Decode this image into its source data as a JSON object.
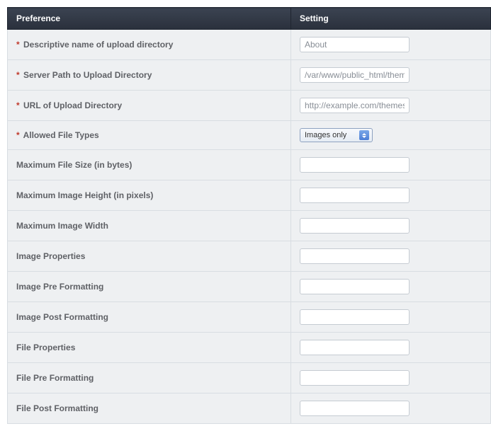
{
  "headers": {
    "preference": "Preference",
    "setting": "Setting"
  },
  "rows": [
    {
      "required": true,
      "label": "Descriptive name of upload directory",
      "type": "text",
      "value": "About"
    },
    {
      "required": true,
      "label": "Server Path to Upload Directory",
      "type": "text",
      "value": "/var/www/public_html/them"
    },
    {
      "required": true,
      "label": "URL of Upload Directory",
      "type": "text",
      "value": "http://example.com/themes"
    },
    {
      "required": true,
      "label": "Allowed File Types",
      "type": "select",
      "value": "Images only"
    },
    {
      "required": false,
      "label": "Maximum File Size (in bytes)",
      "type": "text",
      "value": ""
    },
    {
      "required": false,
      "label": "Maximum Image Height (in pixels)",
      "type": "text",
      "value": ""
    },
    {
      "required": false,
      "label": "Maximum Image Width",
      "type": "text",
      "value": ""
    },
    {
      "required": false,
      "label": "Image Properties",
      "type": "text",
      "value": ""
    },
    {
      "required": false,
      "label": "Image Pre Formatting",
      "type": "text",
      "value": ""
    },
    {
      "required": false,
      "label": "Image Post Formatting",
      "type": "text",
      "value": ""
    },
    {
      "required": false,
      "label": "File Properties",
      "type": "text",
      "value": ""
    },
    {
      "required": false,
      "label": "File Pre Formatting",
      "type": "text",
      "value": ""
    },
    {
      "required": false,
      "label": "File Post Formatting",
      "type": "text",
      "value": ""
    }
  ],
  "required_marker": "*"
}
